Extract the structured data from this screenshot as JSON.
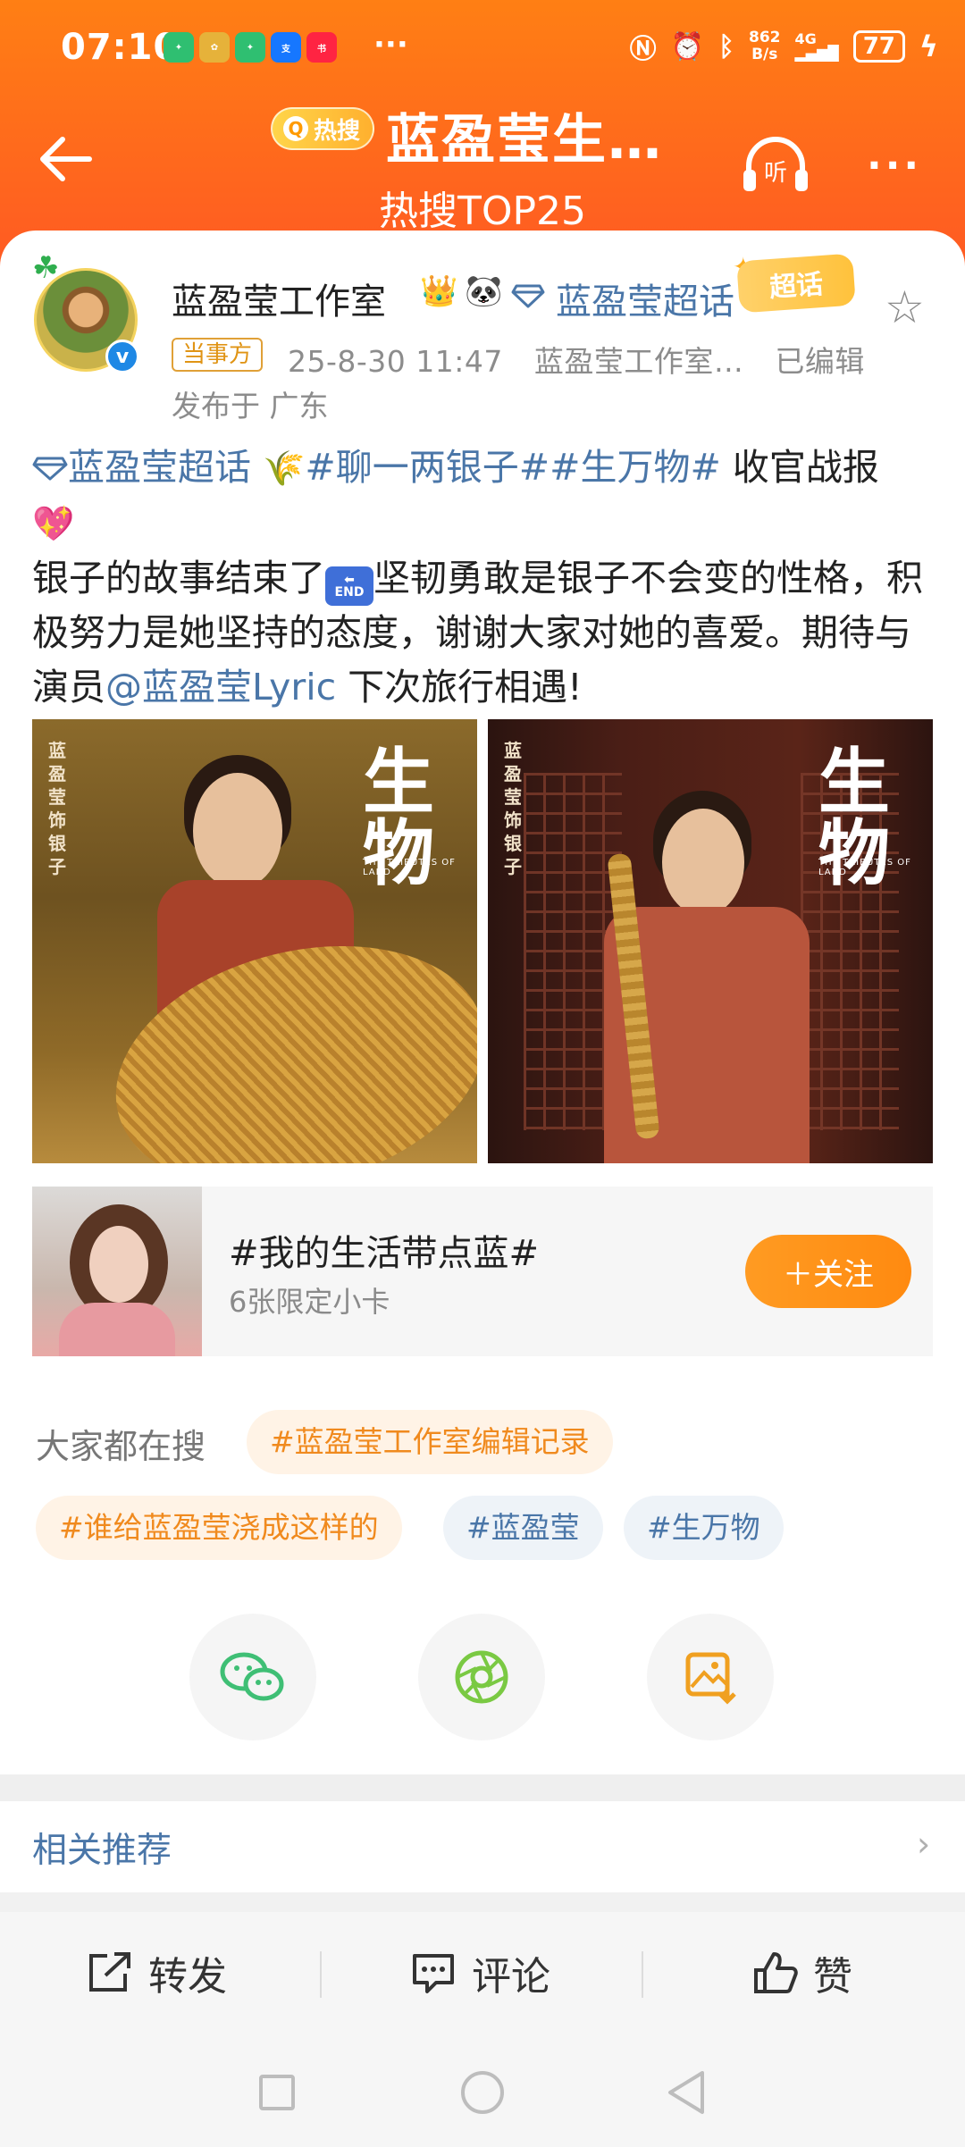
{
  "status_bar": {
    "time": "07:10",
    "app_icons": [
      "green-app-icon",
      "game-app-icon",
      "green-app-icon",
      "alipay-icon",
      "xiaohongshu-icon"
    ],
    "overflow": "···",
    "net_speed_value": "862",
    "net_speed_unit": "B/s",
    "network": "4G",
    "battery": "77",
    "colors": {
      "text": "#ffffff"
    }
  },
  "header": {
    "hot_badge": "热搜",
    "title": "蓝盈莹生…",
    "subtitle": "热搜TOP25",
    "listen_label": "听",
    "more": "···",
    "colors": {
      "gradient_top": "#ff7f14",
      "gradient_bottom": "#ff5a23"
    }
  },
  "post": {
    "username": "蓝盈莹工作室",
    "crown_emoji": "👑",
    "panda_emoji": "🐼",
    "supertopic": "蓝盈莹超话",
    "chaohua_badge": "超话",
    "role_tag": "当事方",
    "date": "25-8-30 11:47",
    "source": "蓝盈莹工作室…",
    "edited": "已编辑",
    "location": "发布于 广东",
    "body": {
      "supertopic_link": "蓝盈莹超话",
      "wheat_emoji": "🌾",
      "hashtag1": "#聊一两银子#",
      "hashtag2": "#生万物#",
      "text1": " 收官战报",
      "heart_emoji": "💖",
      "text2": "银子的故事结束了",
      "end_label": "END",
      "text3": "坚韧勇敢是银子不会变的性格，积极努力是她坚持的态度，谢谢大家对她的喜爱。期待与演员",
      "mention": "@蓝盈莹Lyric",
      "text4": " 下次旅行相遇!"
    },
    "images": [
      {
        "vertical_name": "蓝\n盈\n莹\n饰\n银\n子",
        "logo": "生物",
        "logo_sub": "THE TRIBUTES OF LAND"
      },
      {
        "vertical_name": "蓝\n盈\n莹\n饰\n银\n子",
        "logo": "生物",
        "logo_sub": "THE TRIBUTES OF LAND"
      }
    ]
  },
  "promo": {
    "title": "#我的生活带点蓝#",
    "subtitle": "6张限定小卡",
    "follow_label": "＋关注"
  },
  "search": {
    "label": "大家都在搜",
    "tags": [
      {
        "text": "#蓝盈莹工作室编辑记录",
        "style": "orange"
      },
      {
        "text": "#谁给蓝盈莹浇成这样的",
        "style": "orange"
      },
      {
        "text": "#蓝盈莹",
        "style": "blue"
      },
      {
        "text": "#生万物",
        "style": "blue"
      }
    ]
  },
  "share": [
    "wechat-icon",
    "moments-icon",
    "save-image-icon"
  ],
  "related": {
    "label": "相关推荐",
    "chevron": "›"
  },
  "actions": {
    "repost": "转发",
    "comment": "评论",
    "like": "赞"
  }
}
